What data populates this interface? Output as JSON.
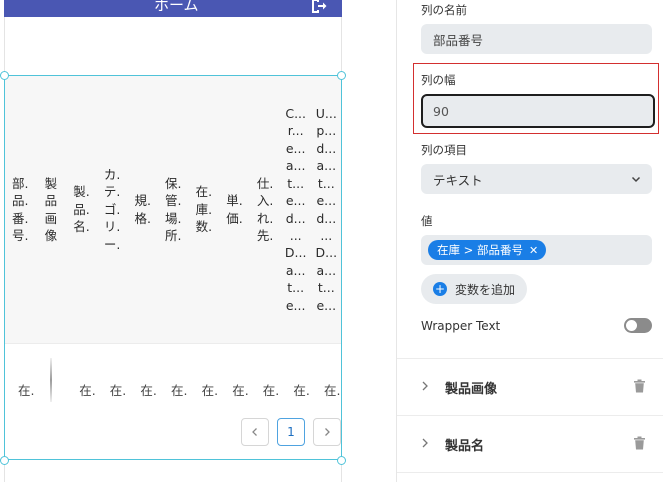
{
  "app_bar": {
    "title": "ホーム",
    "bg_color": "#4a57b3",
    "logout_icon": "logout-icon"
  },
  "table": {
    "headers": [
      [
        "部.",
        "品.",
        "番.",
        "号."
      ],
      [
        "製",
        "品",
        "画",
        "像"
      ],
      [
        "製.",
        "品.",
        "名."
      ],
      [
        "カ.",
        "テ.",
        "ゴ.",
        "リ.",
        "ー."
      ],
      [
        "規.",
        "格."
      ],
      [
        "保.",
        "管.",
        "場.",
        "所."
      ],
      [
        "在.",
        "庫.",
        "数."
      ],
      [
        "単.",
        "価."
      ],
      [
        "仕.",
        "入.",
        "れ.",
        "先."
      ],
      [
        "C...",
        "r...",
        "e...",
        "a...",
        "t...",
        "e...",
        "d...",
        "...",
        "D...",
        "a...",
        "t...",
        "e..."
      ],
      [
        "U...",
        "p...",
        "d...",
        "a...",
        "t...",
        "e...",
        "d...",
        "...",
        "D...",
        "a...",
        "t...",
        "e..."
      ]
    ],
    "row_cells": [
      "在.",
      "",
      "在.",
      "在.",
      "在.",
      "在.",
      "在.",
      "在.",
      "在.",
      "在.",
      "在."
    ],
    "pagination": {
      "prev_icon": "chevron-left-icon",
      "current_page": "1",
      "next_icon": "chevron-right-icon"
    }
  },
  "panel": {
    "column_name_label": "列の名前",
    "column_name_value": "部品番号",
    "column_width_label": "列の幅",
    "column_width_value": "90",
    "column_item_label": "列の項目",
    "column_item_value": "テキスト",
    "value_label": "値",
    "value_chip": "在庫 > 部品番号",
    "add_variable_label": "変数を追加",
    "wrapper_text_label": "Wrapper Text",
    "wrapper_text_on": false,
    "accordions": [
      {
        "label": "製品画像"
      },
      {
        "label": "製品名"
      }
    ],
    "accent_color": "#1a7ee6",
    "highlight_color": "#d32f2f"
  }
}
